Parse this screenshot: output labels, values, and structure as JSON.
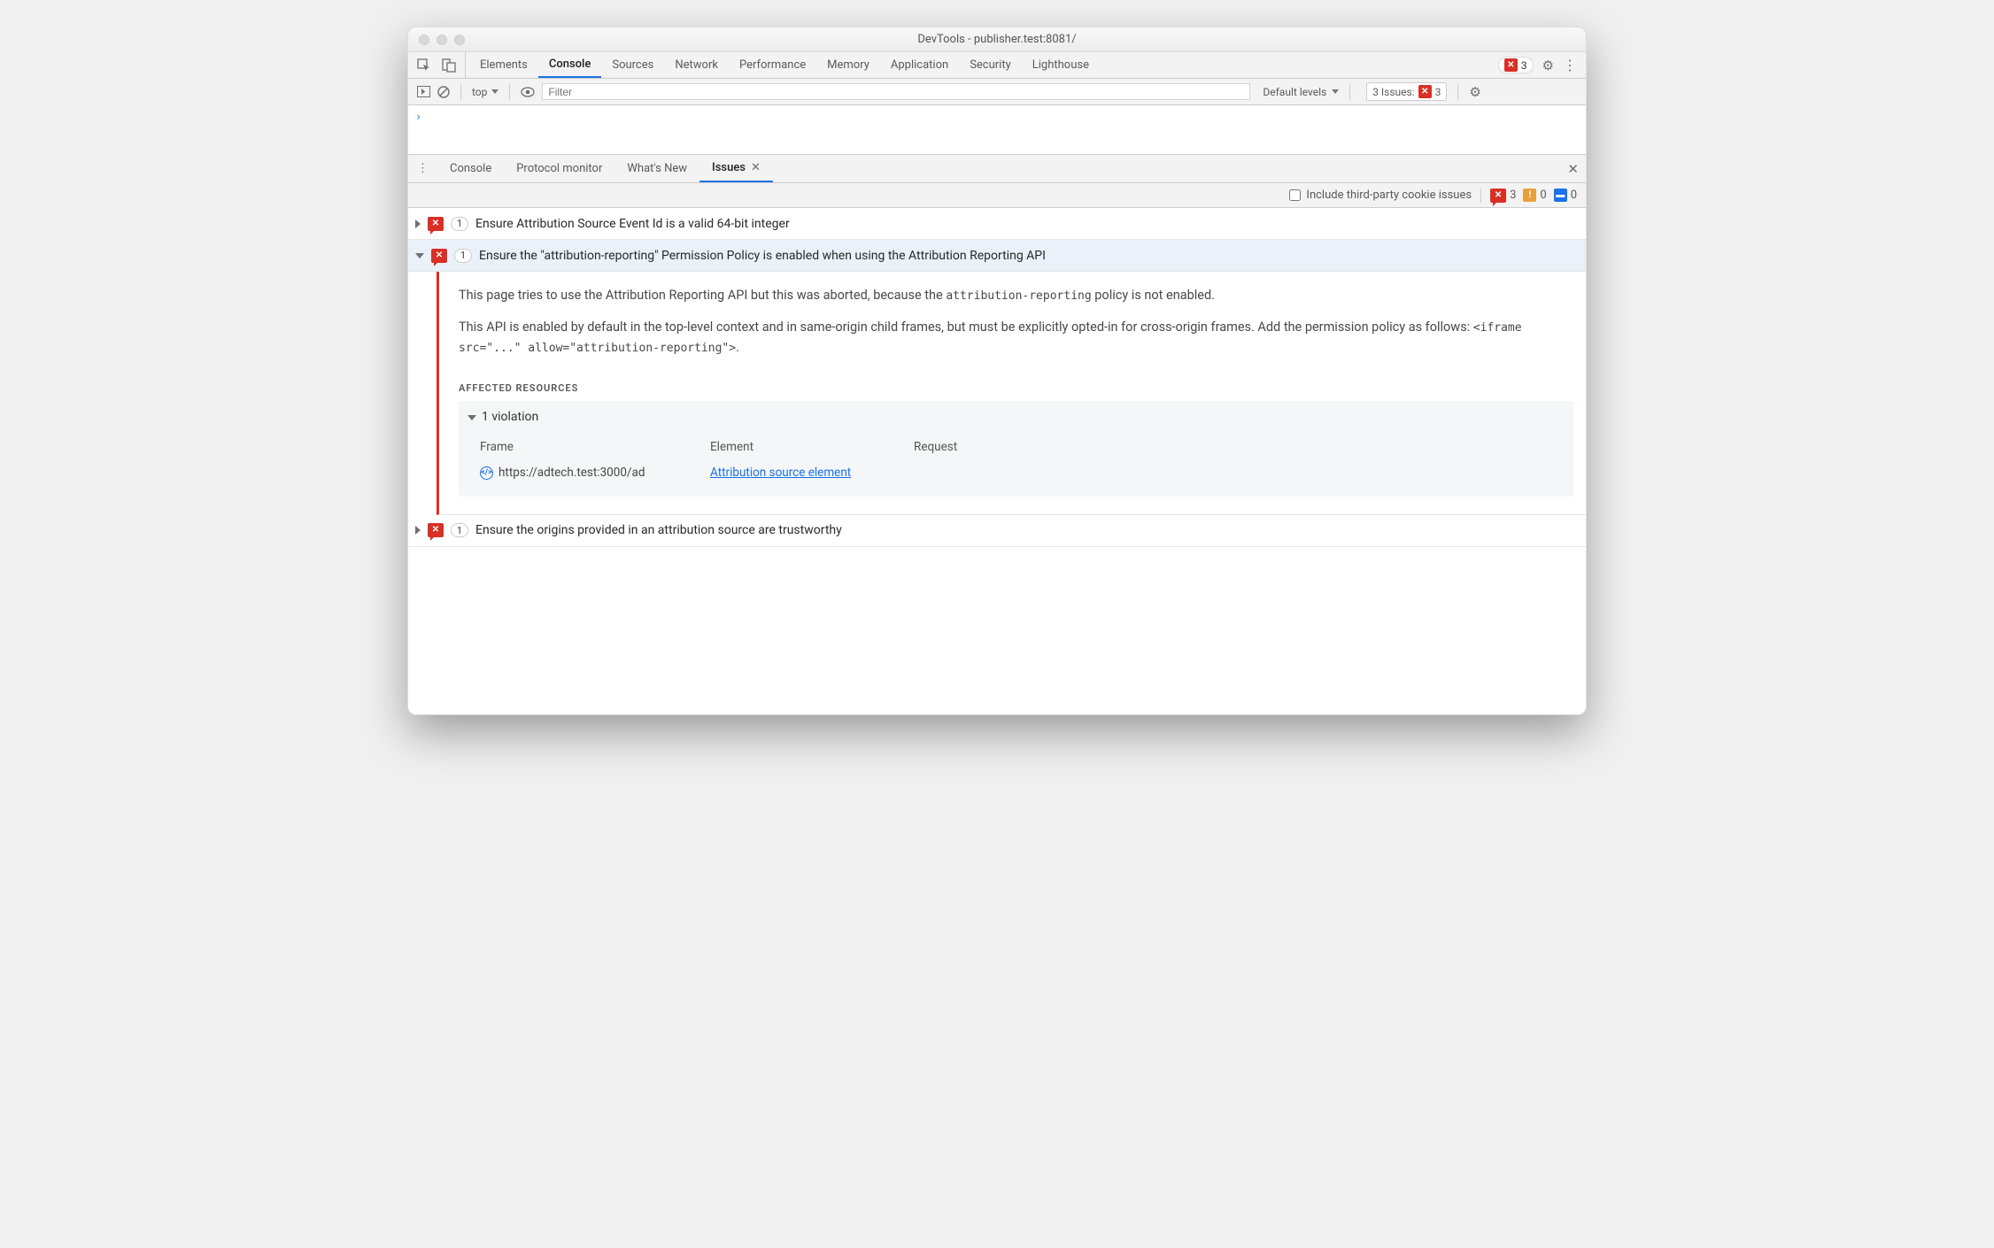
{
  "window": {
    "title": "DevTools - publisher.test:8081/"
  },
  "mainTabs": [
    "Elements",
    "Console",
    "Sources",
    "Network",
    "Performance",
    "Memory",
    "Application",
    "Security",
    "Lighthouse"
  ],
  "mainTabActive": "Console",
  "topRight": {
    "errCount": "3"
  },
  "toolbar": {
    "context": "top",
    "filterPlaceholder": "Filter",
    "levels": "Default levels",
    "issuesLabel": "3 Issues:",
    "issuesCount": "3"
  },
  "consolePrompt": "›",
  "drawerTabs": [
    "Console",
    "Protocol monitor",
    "What's New",
    "Issues"
  ],
  "drawerActive": "Issues",
  "drawerBar": {
    "checkboxLabel": "Include third-party cookie issues",
    "errCount": "3",
    "warnCount": "0",
    "infoCount": "0"
  },
  "issues": [
    {
      "count": "1",
      "title": "Ensure Attribution Source Event Id is a valid 64-bit integer",
      "expanded": false
    },
    {
      "count": "1",
      "title": "Ensure the \"attribution-reporting\" Permission Policy is enabled when using the Attribution Reporting API",
      "expanded": true
    },
    {
      "count": "1",
      "title": "Ensure the origins provided in an attribution source are trustworthy",
      "expanded": false
    }
  ],
  "detail": {
    "para1_a": "This page tries to use the Attribution Reporting API but this was aborted, because the ",
    "para1_code": "attribution-reporting",
    "para1_b": " policy is not enabled.",
    "para2_a": "This API is enabled by default in the top-level context and in same-origin child frames, but must be explicitly opted-in for cross-origin frames. Add the permission policy as follows: ",
    "para2_code": "<iframe src=\"...\" allow=\"attribution-reporting\">",
    "para2_b": ".",
    "affectedHeading": "AFFECTED RESOURCES",
    "violationTitle": "1 violation",
    "headers": {
      "frame": "Frame",
      "element": "Element",
      "request": "Request"
    },
    "row": {
      "frame": "https://adtech.test:3000/ad",
      "element": "Attribution source element",
      "request": ""
    }
  }
}
